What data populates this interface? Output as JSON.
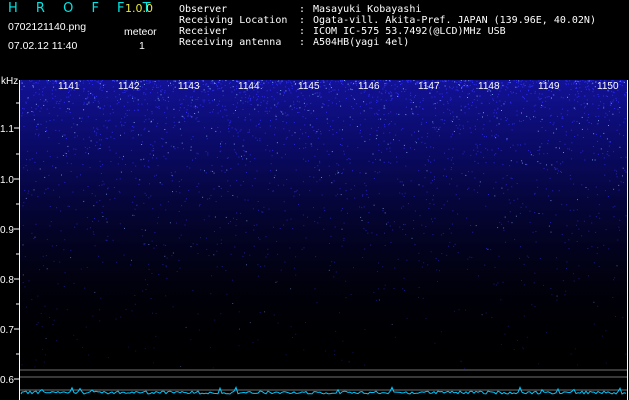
{
  "header": {
    "app_title": "H R O F F T",
    "app_version": "1.0.0",
    "filename": "0702121140.png",
    "datetime": "07.02.12 11:40",
    "mode_label": "meteor",
    "mode_count": "1"
  },
  "station_info": [
    {
      "key": "Observer",
      "value": "Masayuki Kobayashi"
    },
    {
      "key": "Receiving Location",
      "value": "Ogata-vill. Akita-Pref. JAPAN (139.96E, 40.02N)"
    },
    {
      "key": "Receiver",
      "value": "ICOM IC-575 53.7492(@LCD)MHz USB"
    },
    {
      "key": "Receiving antenna",
      "value": "A504HB(yagi 4el)"
    }
  ],
  "spectrogram": {
    "y_unit": "kHz",
    "y_ticks": [
      "1.1",
      "1.0",
      "0.9",
      "0.8",
      "0.7",
      "0.6"
    ],
    "time_labels": [
      "1141",
      "1142",
      "1143",
      "1144",
      "1145",
      "1146",
      "1147",
      "1148",
      "1149",
      "1150"
    ],
    "colors": {
      "noise": "#3030ff",
      "noise_bright": "#8fb8ff",
      "axis": "#ffffff",
      "time_label": "#ffffff",
      "baseline": "#6f6f6f",
      "trace": "#00c8ff"
    }
  }
}
